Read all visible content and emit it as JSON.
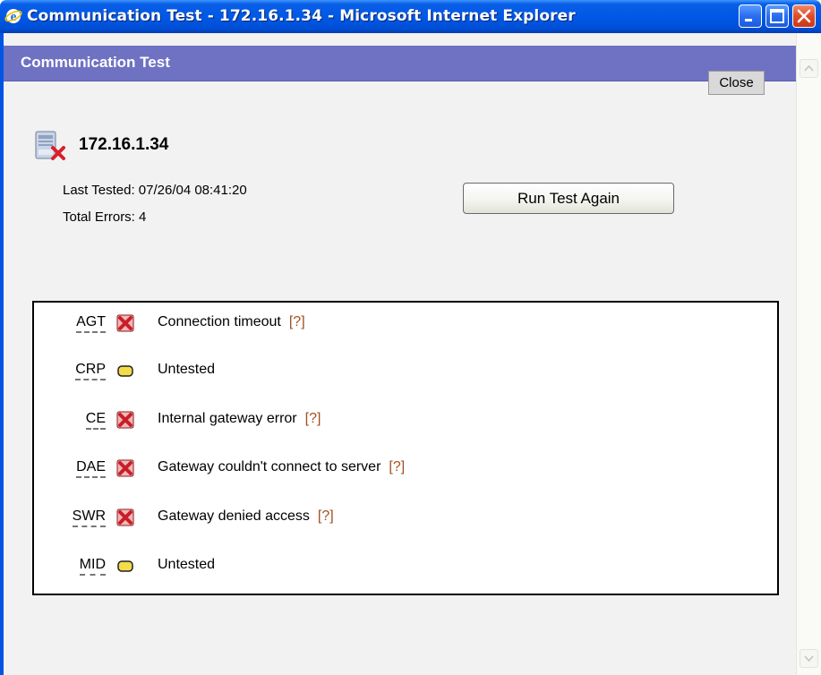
{
  "window": {
    "title": "Communication Test - 172.16.1.34 - Microsoft Internet Explorer"
  },
  "header": {
    "title": "Communication Test",
    "close_label": "Close"
  },
  "device": {
    "ip": "172.16.1.34",
    "last_tested": "Last Tested: 07/26/04 08:41:20",
    "total_errors": "Total Errors: 4",
    "run_test_label": "Run Test Again"
  },
  "results": [
    {
      "code": "AGT",
      "status": "error",
      "message": "Connection timeout",
      "help": "[?]"
    },
    {
      "code": "CRP",
      "status": "untested",
      "message": "Untested",
      "help": ""
    },
    {
      "code": "CE",
      "status": "error",
      "message": "Internal gateway error",
      "help": "[?]"
    },
    {
      "code": "DAE",
      "status": "error",
      "message": "Gateway couldn't connect to server",
      "help": "[?]"
    },
    {
      "code": "SWR",
      "status": "error",
      "message": "Gateway denied access",
      "help": "[?]"
    },
    {
      "code": "MID",
      "status": "untested",
      "message": "Untested",
      "help": ""
    }
  ],
  "colors": {
    "header_bg": "#6f72c2",
    "error_icon": "#c81e2a",
    "untested_icon": "#f2dc4a",
    "help_link": "#a05020"
  }
}
